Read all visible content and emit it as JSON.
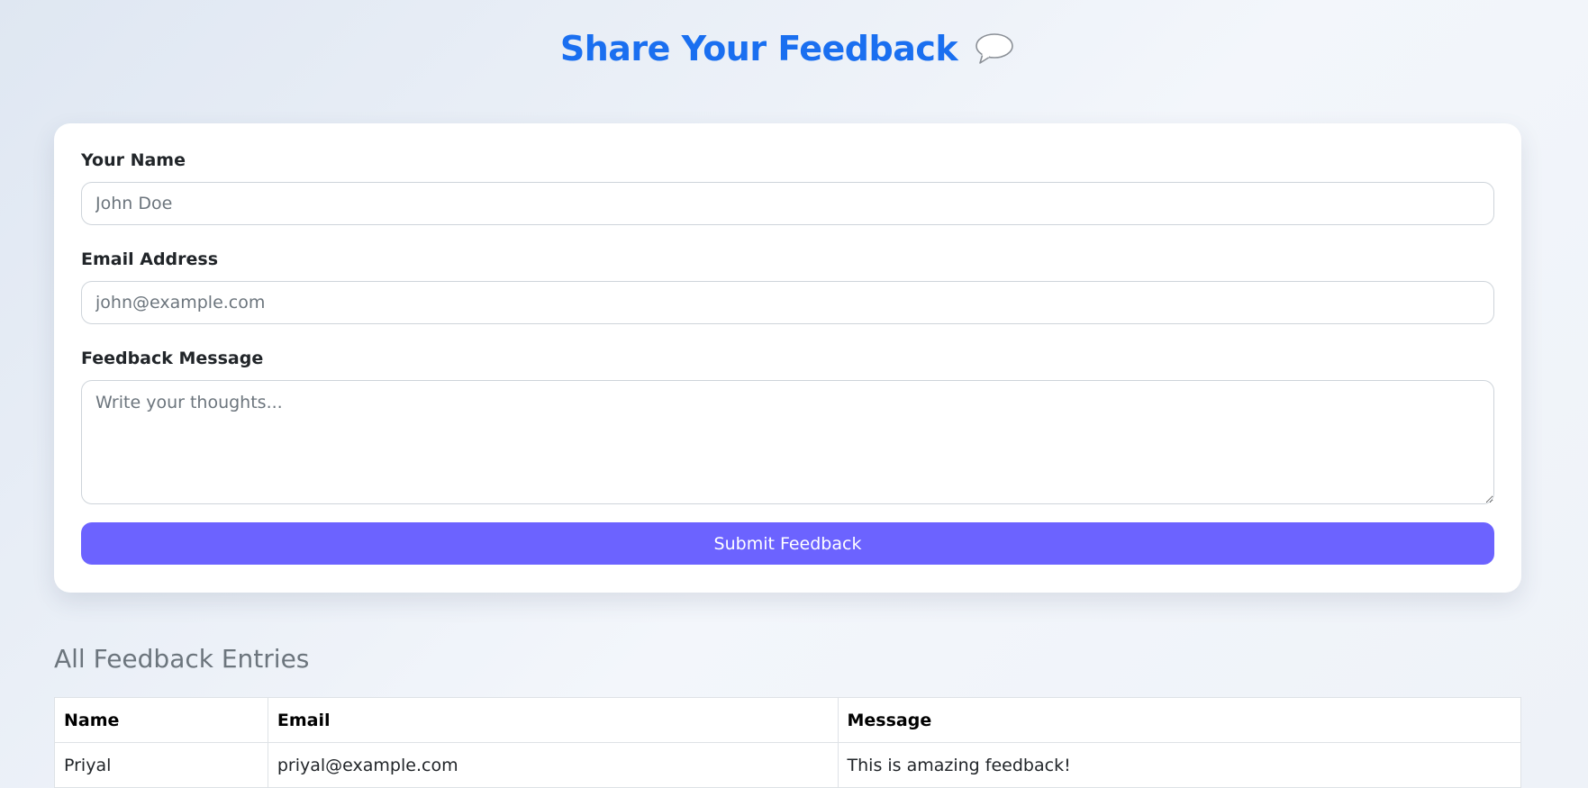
{
  "header": {
    "title": "Share Your Feedback",
    "icon": "speech-bubble-icon"
  },
  "form": {
    "name_label": "Your Name",
    "name_placeholder": "John Doe",
    "name_value": "",
    "email_label": "Email Address",
    "email_placeholder": "john@example.com",
    "email_value": "",
    "message_label": "Feedback Message",
    "message_placeholder": "Write your thoughts...",
    "message_value": "",
    "submit_label": "Submit Feedback"
  },
  "entries": {
    "title": "All Feedback Entries",
    "columns": [
      "Name",
      "Email",
      "Message"
    ],
    "rows": [
      [
        "Priyal",
        "priyal@example.com",
        "This is amazing feedback!"
      ]
    ]
  },
  "colors": {
    "title": "#1a6ff0",
    "button": "#6c63ff",
    "section_title": "#6c757d"
  }
}
